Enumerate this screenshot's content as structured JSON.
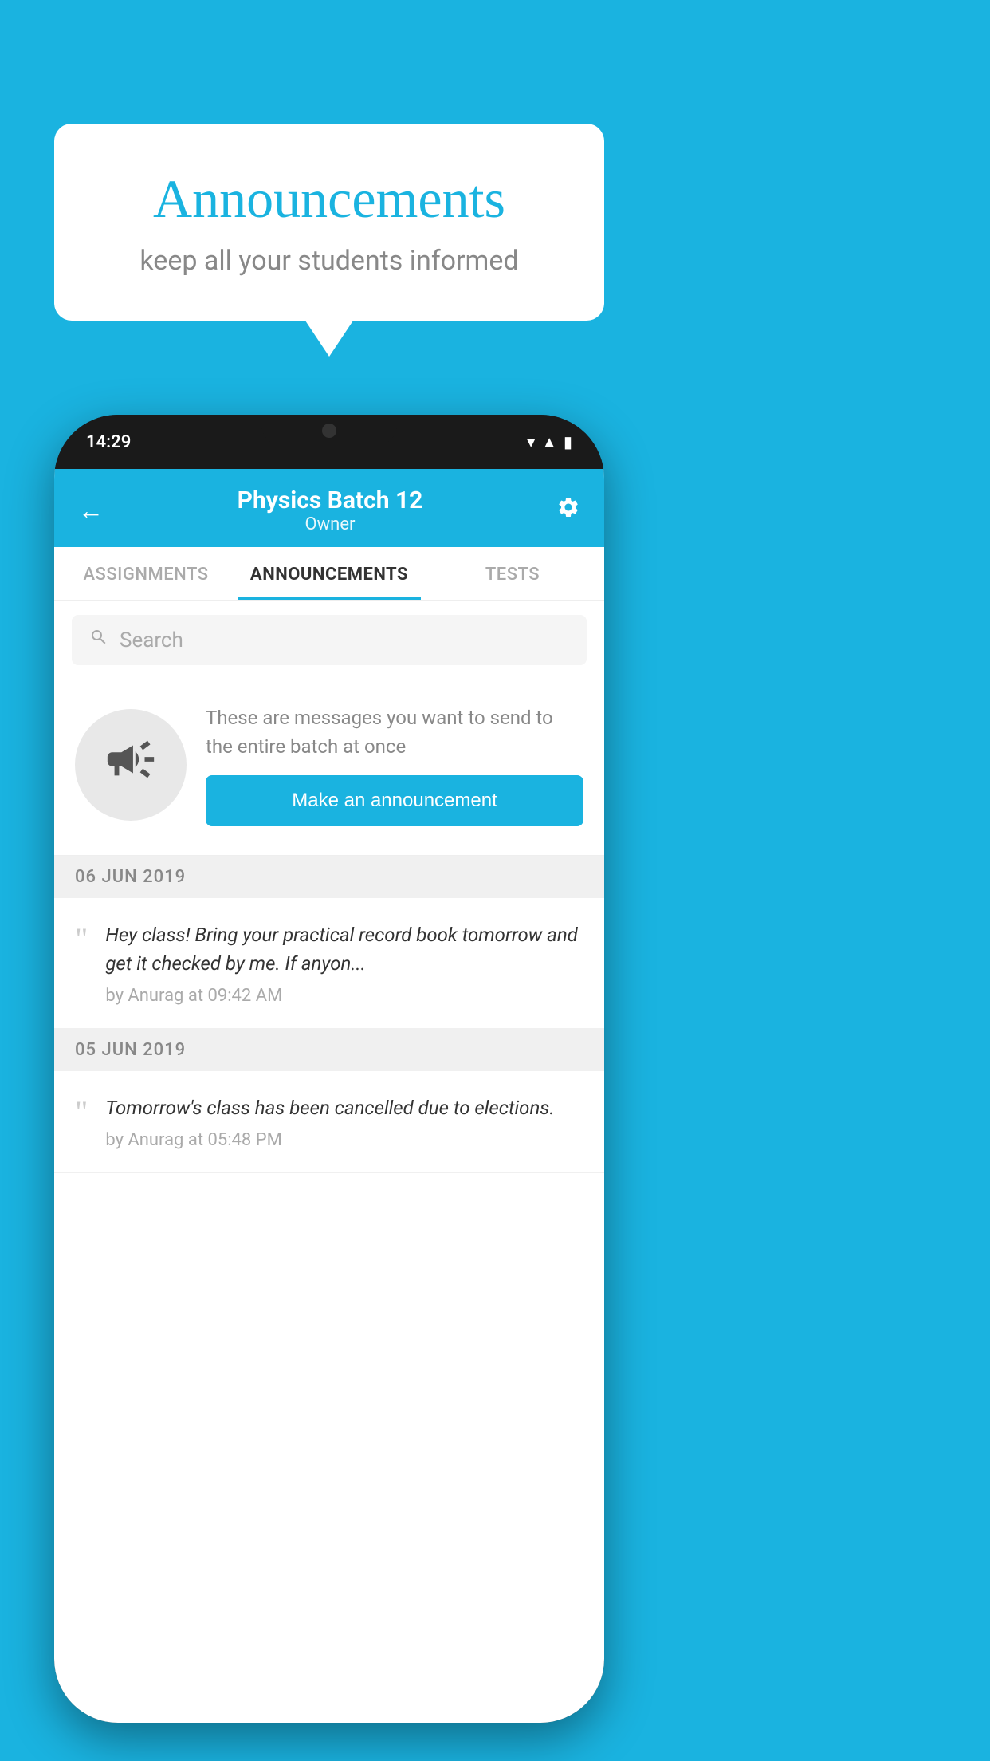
{
  "background_color": "#1ab3e0",
  "speech_bubble": {
    "title": "Announcements",
    "subtitle": "keep all your students informed"
  },
  "phone": {
    "status_bar": {
      "time": "14:29",
      "icons": [
        "wifi",
        "signal",
        "battery"
      ]
    },
    "header": {
      "title": "Physics Batch 12",
      "subtitle": "Owner",
      "back_label": "←",
      "gear_label": "⚙"
    },
    "tabs": [
      {
        "label": "ASSIGNMENTS",
        "active": false
      },
      {
        "label": "ANNOUNCEMENTS",
        "active": true
      },
      {
        "label": "TESTS",
        "active": false
      },
      {
        "label": "...",
        "active": false
      }
    ],
    "search": {
      "placeholder": "Search"
    },
    "promo": {
      "description": "These are messages you want to send to the entire batch at once",
      "button_label": "Make an announcement"
    },
    "announcements": [
      {
        "date": "06  JUN  2019",
        "message": "Hey class! Bring your practical record book tomorrow and get it checked by me. If anyon...",
        "meta": "by Anurag at 09:42 AM"
      },
      {
        "date": "05  JUN  2019",
        "message": "Tomorrow's class has been cancelled due to elections.",
        "meta": "by Anurag at 05:48 PM"
      }
    ]
  }
}
